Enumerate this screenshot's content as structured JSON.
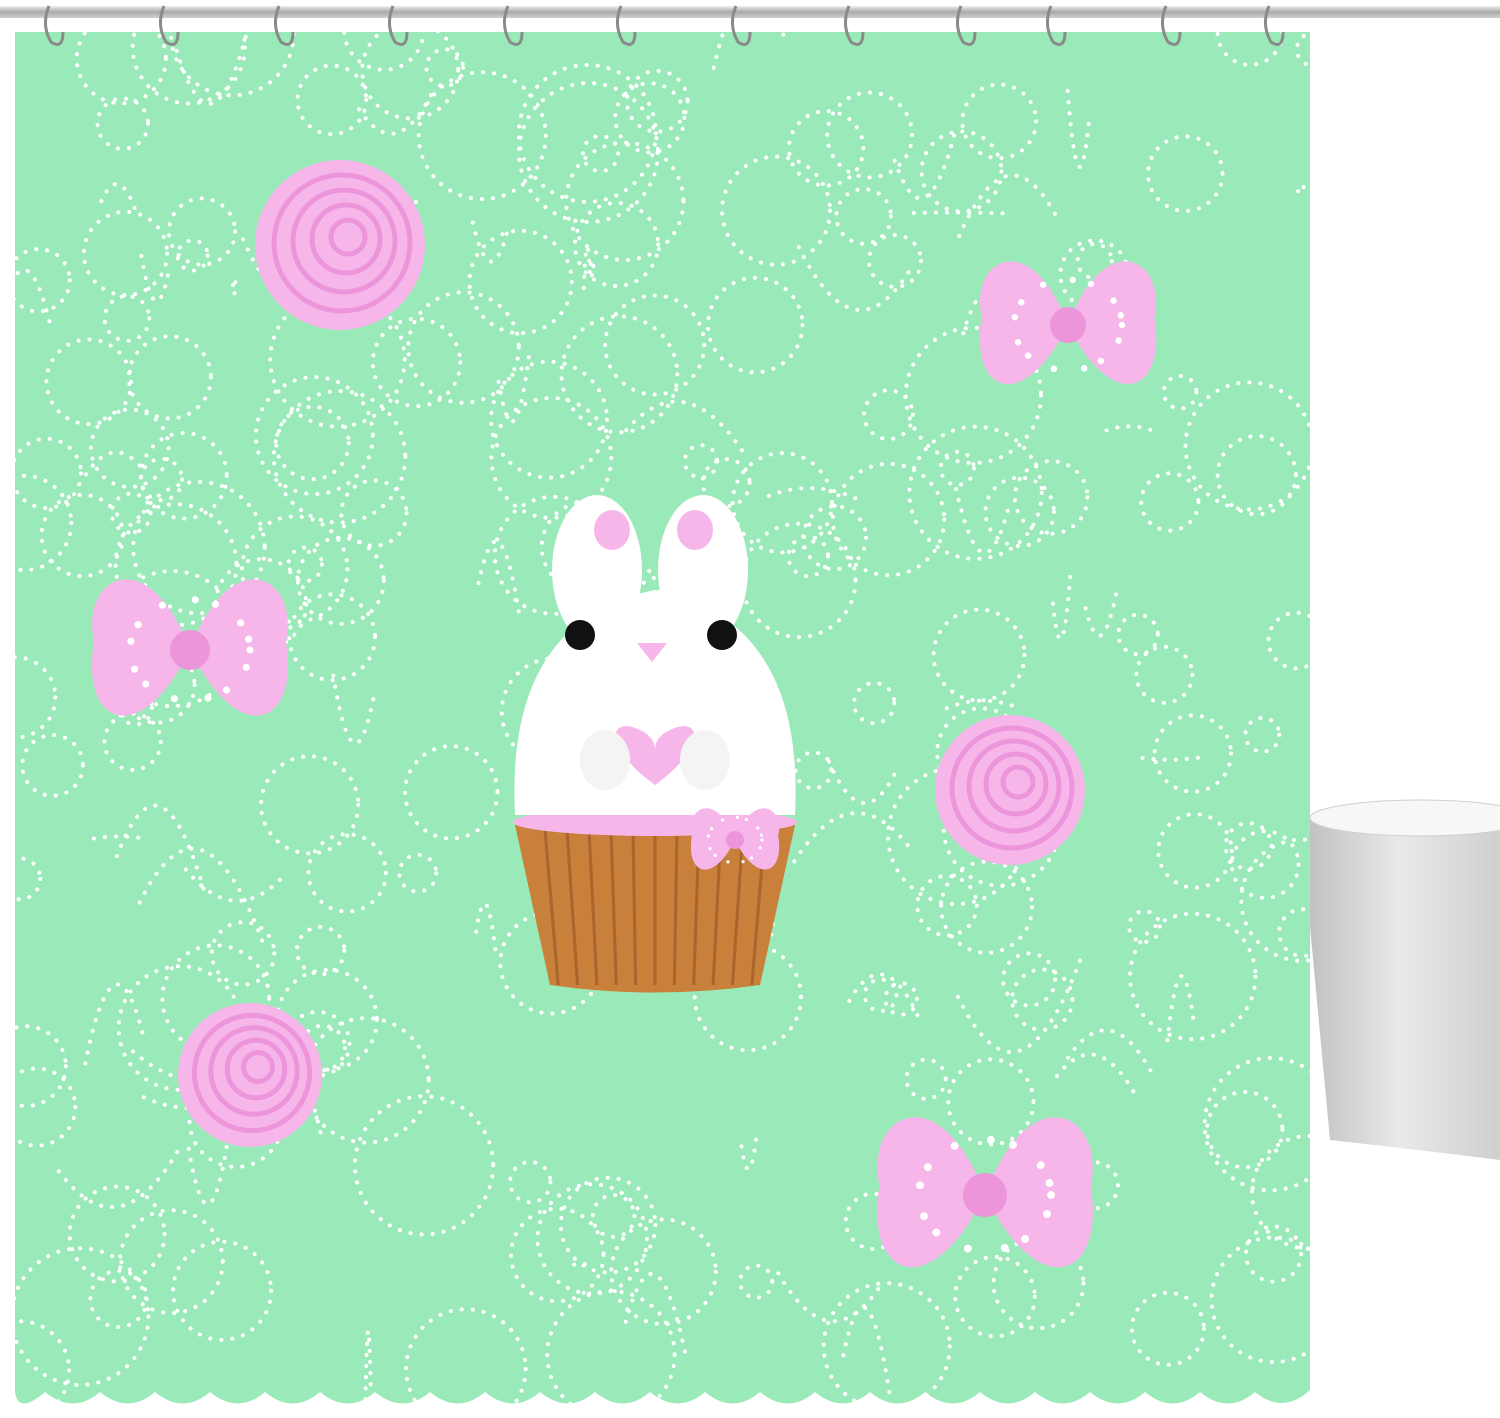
{
  "product": {
    "type": "shower-curtain",
    "hook_count": 12,
    "colors": {
      "curtain": "#9ae9b8",
      "dots": "#ffffff",
      "pink": "#f7b6ea",
      "pink_dark": "#ec95da",
      "liner": "#c8803a",
      "tub": "#e6e6e6"
    },
    "motifs": {
      "roses": 3,
      "bows": 4,
      "bunny_cupcake": 1
    }
  }
}
